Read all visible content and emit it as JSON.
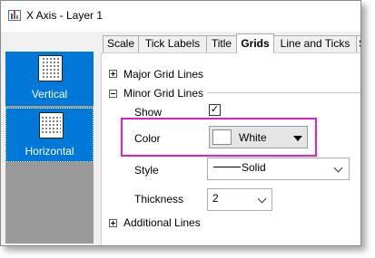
{
  "window": {
    "title": "X Axis - Layer 1"
  },
  "sidebar": {
    "items": [
      {
        "label": "Vertical",
        "icon": "vertical-grid-icon",
        "selected": false
      },
      {
        "label": "Horizontal",
        "icon": "horizontal-grid-icon",
        "selected": true
      }
    ]
  },
  "tabs": [
    {
      "label": "Scale",
      "active": false
    },
    {
      "label": "Tick Labels",
      "active": false
    },
    {
      "label": "Title",
      "active": false
    },
    {
      "label": "Grids",
      "active": true
    },
    {
      "label": "Line and Ticks",
      "active": false
    },
    {
      "label": "S",
      "active": false
    }
  ],
  "panel": {
    "major_grid_lines": "Major Grid Lines",
    "minor_grid_lines": "Minor Grid Lines",
    "show_label": "Show",
    "show_checked": true,
    "color_label": "Color",
    "color_value": "White",
    "color_swatch": "#ffffff",
    "style_label": "Style",
    "style_value": "Solid",
    "thickness_label": "Thickness",
    "thickness_value": "2",
    "additional_lines": "Additional Lines"
  },
  "colors": {
    "selection": "#0078d7",
    "highlight_frame": "#e020c8"
  }
}
